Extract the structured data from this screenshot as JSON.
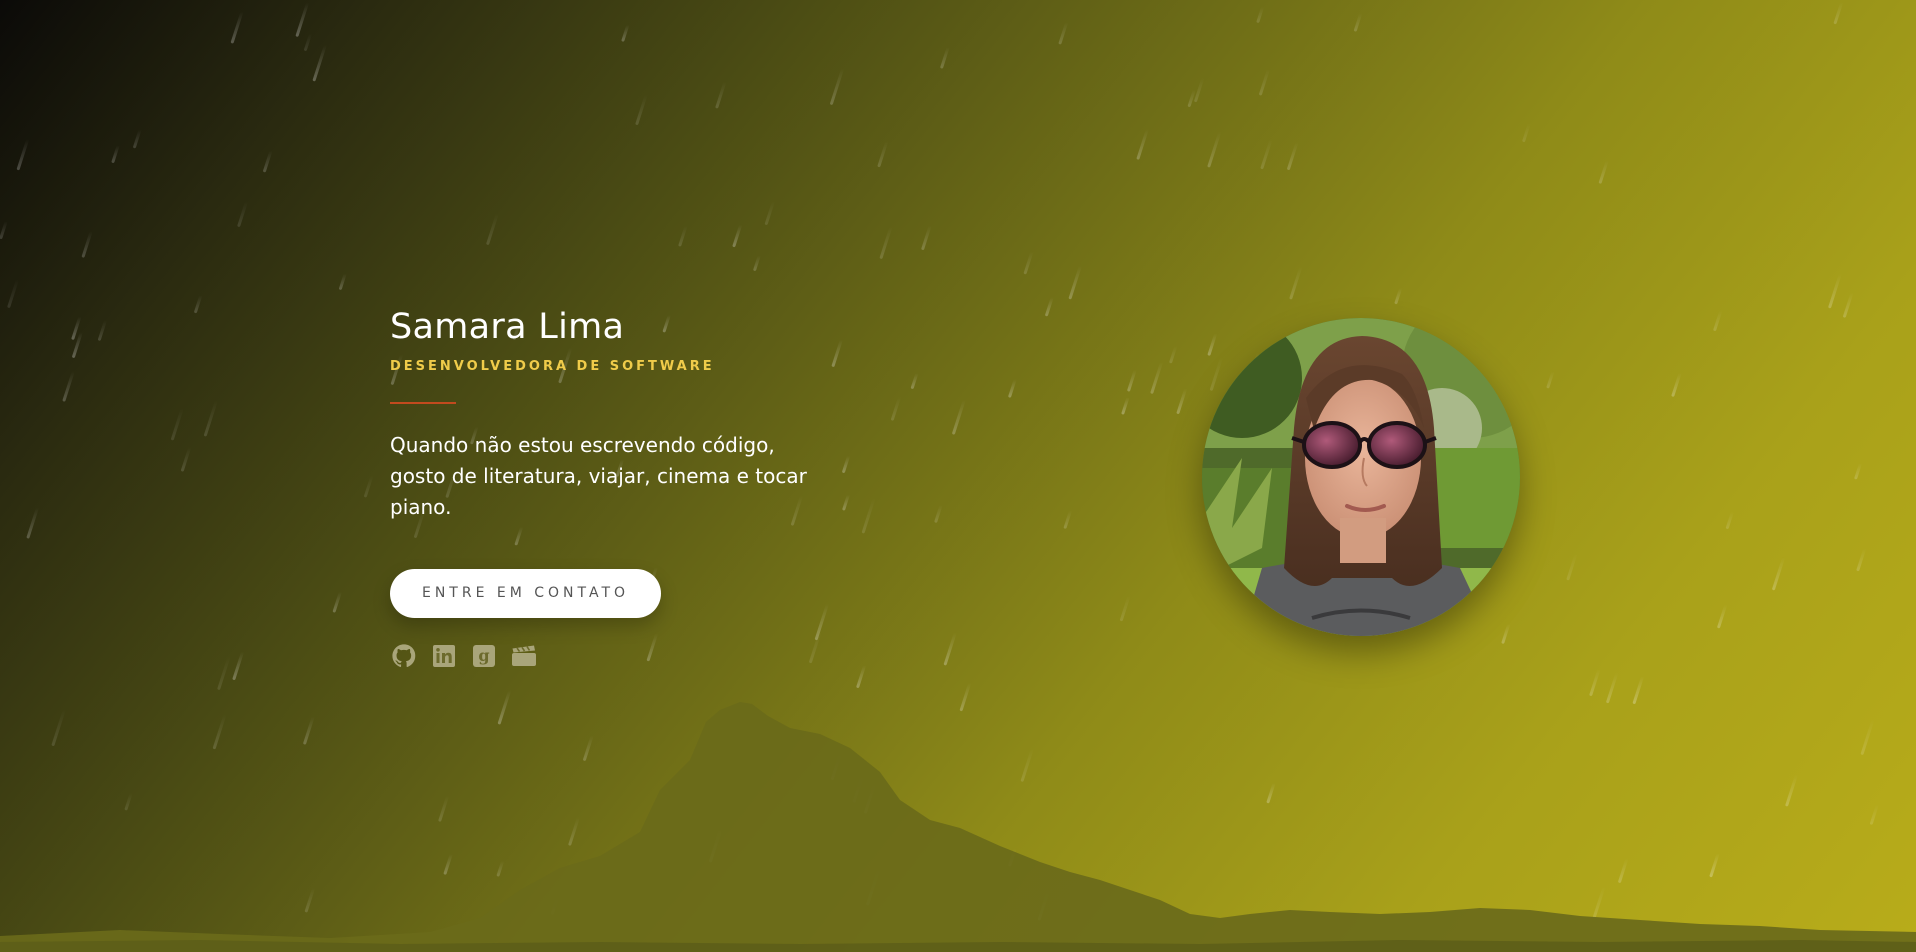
{
  "profile": {
    "name": "Samara Lima",
    "role": "DESENVOLVEDORA DE SOFTWARE",
    "bio": "Quando não estou escrevendo código, gosto de literatura, viajar, cinema e tocar piano.",
    "cta_label": "ENTRE EM CONTATO"
  },
  "social": [
    {
      "icon": "github-icon"
    },
    {
      "icon": "linkedin-icon"
    },
    {
      "icon": "goodreads-icon"
    },
    {
      "icon": "film-clapper-icon"
    }
  ],
  "colors": {
    "accent_role": "#f0cc4a",
    "divider": "#c24a1e",
    "icon": "#a9a57a",
    "button_bg": "#ffffff",
    "button_text": "#555555"
  }
}
